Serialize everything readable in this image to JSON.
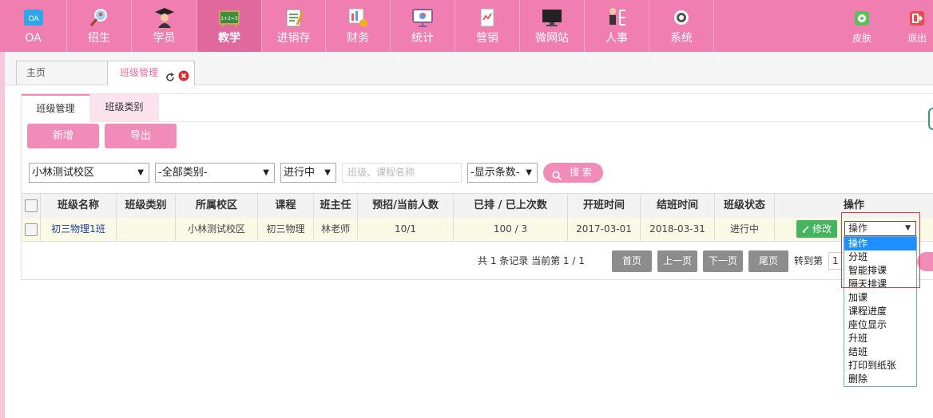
{
  "nav": {
    "items": [
      {
        "label": "OA"
      },
      {
        "label": "招生"
      },
      {
        "label": "学员"
      },
      {
        "label": "教学"
      },
      {
        "label": "进销存"
      },
      {
        "label": "财务"
      },
      {
        "label": "统计"
      },
      {
        "label": "营销"
      },
      {
        "label": "微网站"
      },
      {
        "label": "人事"
      },
      {
        "label": "系统"
      }
    ],
    "skin_label": "皮肤",
    "logout_label": "退出",
    "oa_icon_text": "OA",
    "active_index": 3
  },
  "tabs": {
    "home": "主页",
    "current": "班级管理"
  },
  "subtabs": [
    "班级管理",
    "班级类别"
  ],
  "actions": {
    "add": "新增",
    "export": "导出"
  },
  "filters": {
    "campus": "小林测试校区",
    "category": "-全部类别-",
    "status": "进行中",
    "search_placeholder": "班级、课程名称",
    "page_size": "-显示条数-",
    "search_button": "搜 索"
  },
  "table": {
    "headers": [
      "班级名称",
      "班级类别",
      "所属校区",
      "课程",
      "班主任",
      "预招/当前人数",
      "已排 / 已上次数",
      "开班时间",
      "结班时间",
      "班级状态",
      "操作"
    ],
    "rows": [
      {
        "name": "初三物理1班",
        "category": "",
        "campus": "小林测试校区",
        "course": "初三物理",
        "teacher": "林老师",
        "count": "10/1",
        "sessions": "100 / 3",
        "start": "2017-03-01",
        "end": "2018-03-31",
        "state": "进行中",
        "edit": "修改",
        "op": "操作"
      }
    ]
  },
  "operations": [
    "操作",
    "分班",
    "智能排课",
    "隔天排课",
    "加课",
    "课程进度",
    "座位显示",
    "升班",
    "结班",
    "打印到纸张",
    "删除"
  ],
  "pager": {
    "summary": "共 1 条记录 当前第 1 / 1",
    "first": "首页",
    "prev": "上一页",
    "next": "下一页",
    "last": "尾页",
    "goto": "转到第",
    "page_value": "1"
  },
  "colors": {
    "accent": "#f17eb0",
    "accent_active": "#e0689d",
    "button": "#f08cb7",
    "edit": "#46b35e",
    "highlight": "#1e90ff"
  }
}
